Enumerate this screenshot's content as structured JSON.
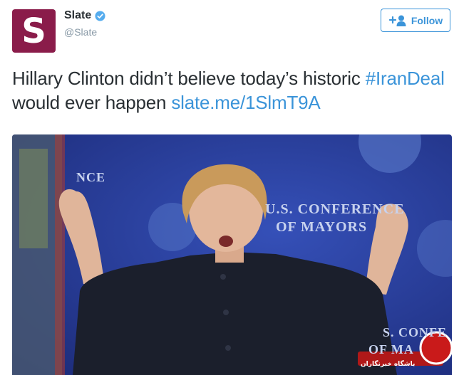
{
  "author": {
    "name": "Slate",
    "handle": "@Slate",
    "avatar_letter": "S",
    "verified": true
  },
  "follow_button": {
    "label": "Follow",
    "icon": "add-user-icon"
  },
  "tweet": {
    "text_before_hashtag": "Hillary Clinton didn’t believe today’s historic ",
    "hashtag": "#IranDeal",
    "text_after_hashtag": " would ever happen ",
    "link": "slate.me/1SlmT9A"
  },
  "media": {
    "backdrop_text_line1": "U.S. CONFERENCE",
    "backdrop_text_line2": "OF MAYORS",
    "backdrop_text_left": "NCE",
    "backdrop_text_bottom1": "S. CONFE",
    "backdrop_text_bottom2": "OF MA",
    "watermark_text": "باشگاه خبرنگاران"
  },
  "colors": {
    "link": "#3b94d9",
    "text": "#292f33",
    "muted": "#8899a6",
    "avatar_bg": "#8a1c4a",
    "verified": "#55acee",
    "backdrop": "#2a3f9e"
  }
}
